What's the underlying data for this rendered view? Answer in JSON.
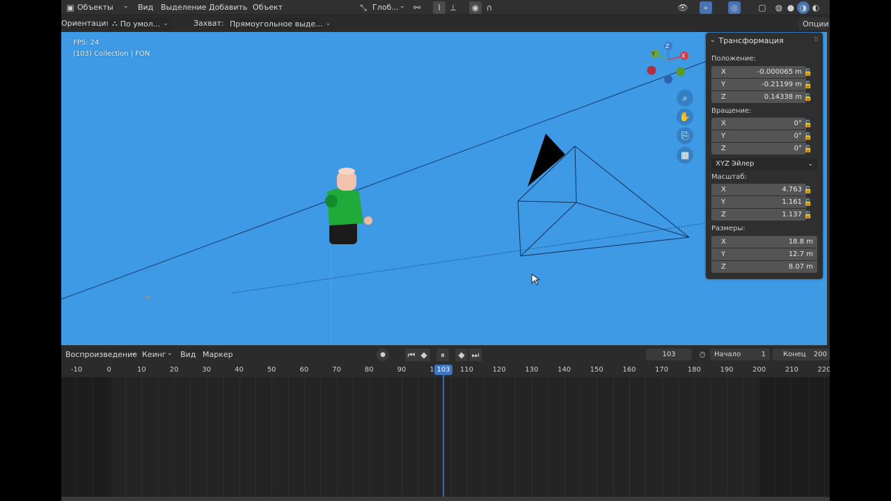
{
  "header": {
    "editor_type": "Объекты",
    "menus": [
      "Вид",
      "Выделение",
      "Добавить",
      "Объект"
    ],
    "transform_orientation": "Глоб...",
    "orientation_label": "Ориентация:",
    "orientation_value": "По умол...",
    "snap_label": "Захват:",
    "snap_value": "Прямоугольное выде...",
    "options_label": "Опции"
  },
  "viewport": {
    "fps": "FPS: 24",
    "collection": "(103) Collection | FON",
    "background_color": "#3f9ae6",
    "gizmo_axes": [
      "Y",
      "Z",
      "X"
    ]
  },
  "transform_panel": {
    "title": "Трансформация",
    "location_label": "Положение:",
    "location": [
      {
        "axis": "X",
        "value": "-0.000065 m"
      },
      {
        "axis": "Y",
        "value": "-0.21199 m"
      },
      {
        "axis": "Z",
        "value": "0.14338 m"
      }
    ],
    "rotation_label": "Вращение:",
    "rotation": [
      {
        "axis": "X",
        "value": "0°"
      },
      {
        "axis": "Y",
        "value": "0°"
      },
      {
        "axis": "Z",
        "value": "0°"
      }
    ],
    "rotation_mode": "XYZ Эйлер",
    "scale_label": "Масштаб:",
    "scale": [
      {
        "axis": "X",
        "value": "4.763"
      },
      {
        "axis": "Y",
        "value": "1.161"
      },
      {
        "axis": "Z",
        "value": "1.137"
      }
    ],
    "dimensions_label": "Размеры:",
    "dimensions": [
      {
        "axis": "X",
        "value": "18.8 m"
      },
      {
        "axis": "Y",
        "value": "12.7 m"
      },
      {
        "axis": "Z",
        "value": "8.07 m"
      }
    ]
  },
  "timeline": {
    "menus": [
      "Воспроизведение",
      "Кеинг",
      "Вид",
      "Маркер"
    ],
    "current_frame": "103",
    "start_label": "Начало",
    "start_value": "1",
    "end_label": "Конец",
    "end_value": "200",
    "ruler_ticks": [
      "-10",
      "0",
      "10",
      "20",
      "30",
      "40",
      "50",
      "60",
      "70",
      "80",
      "90",
      "10",
      "110",
      "120",
      "130",
      "140",
      "150",
      "160",
      "170",
      "180",
      "190",
      "200",
      "210",
      "220"
    ],
    "playhead_label": "103",
    "accent_color": "#3e74c4"
  }
}
